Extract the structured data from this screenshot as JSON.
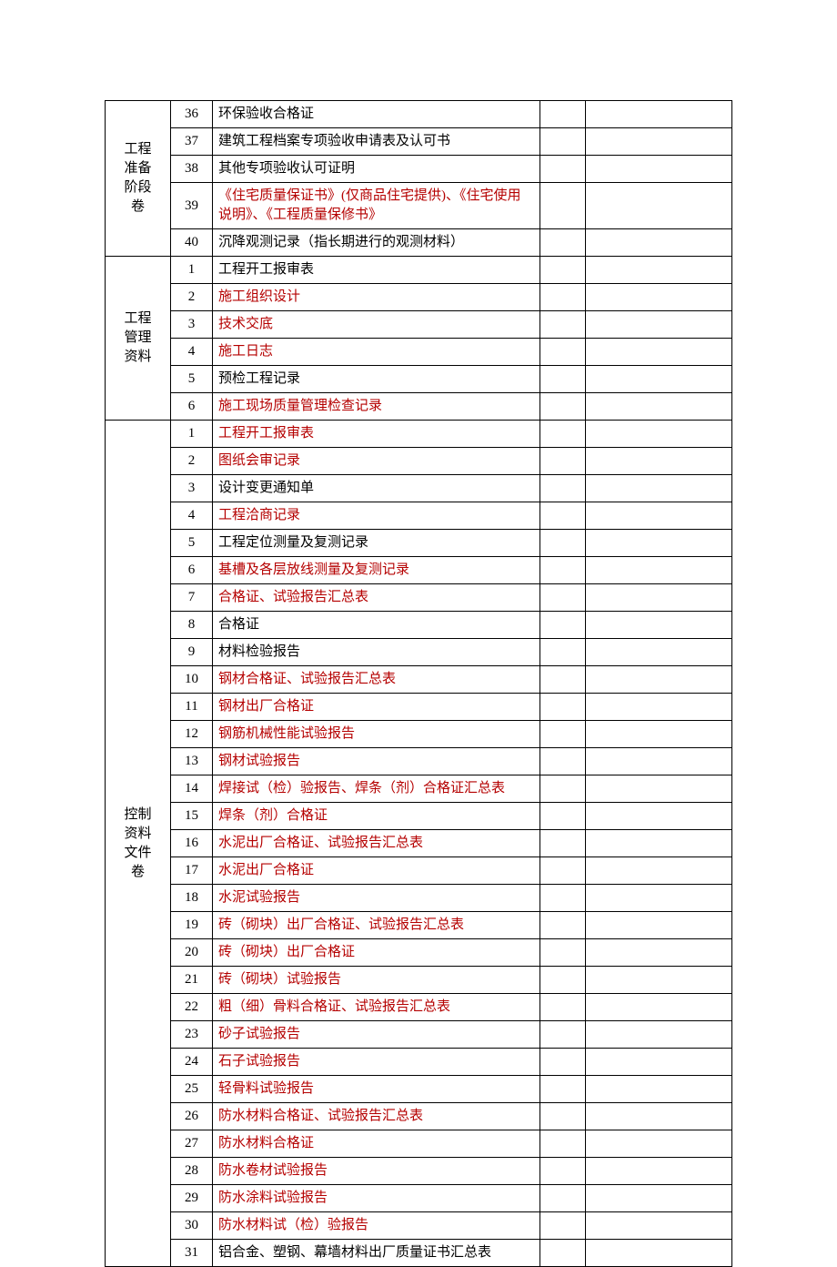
{
  "sections": [
    {
      "group_label": "工程准备阶段卷",
      "rows": [
        {
          "num": "36",
          "name": "环保验收合格证",
          "red": false
        },
        {
          "num": "37",
          "name": "建筑工程档案专项验收申请表及认可书",
          "red": false
        },
        {
          "num": "38",
          "name": "其他专项验收认可证明",
          "red": false
        },
        {
          "num": "39",
          "name": "《住宅质量保证书》(仅商品住宅提供)、《住宅使用说明》、《工程质量保修书》",
          "red": true
        },
        {
          "num": "40",
          "name": "沉降观测记录（指长期进行的观测材料）",
          "red": false
        }
      ]
    },
    {
      "group_label": "工程管理资料",
      "rows": [
        {
          "num": "1",
          "name": "工程开工报审表",
          "red": false
        },
        {
          "num": "2",
          "name": "施工组织设计",
          "red": true
        },
        {
          "num": "3",
          "name": "技术交底",
          "red": true
        },
        {
          "num": "4",
          "name": "施工日志",
          "red": true
        },
        {
          "num": "5",
          "name": "预检工程记录",
          "red": false
        },
        {
          "num": "6",
          "name": "施工现场质量管理检查记录",
          "red": true
        }
      ]
    },
    {
      "group_label": "控制资料文件卷",
      "rows": [
        {
          "num": "1",
          "name": "工程开工报审表",
          "red": true
        },
        {
          "num": "2",
          "name": "图纸会审记录",
          "red": true
        },
        {
          "num": "3",
          "name": "设计变更通知单",
          "red": false
        },
        {
          "num": "4",
          "name": "工程洽商记录",
          "red": true
        },
        {
          "num": "5",
          "name": "工程定位测量及复测记录",
          "red": false
        },
        {
          "num": "6",
          "name": "基槽及各层放线测量及复测记录",
          "red": true
        },
        {
          "num": "7",
          "name": "合格证、试验报告汇总表",
          "red": true
        },
        {
          "num": "8",
          "name": "合格证",
          "red": false
        },
        {
          "num": "9",
          "name": "材料检验报告",
          "red": false
        },
        {
          "num": "10",
          "name": "钢材合格证、试验报告汇总表",
          "red": true
        },
        {
          "num": "11",
          "name": "钢材出厂合格证",
          "red": true
        },
        {
          "num": "12",
          "name": "钢筋机械性能试验报告",
          "red": true
        },
        {
          "num": "13",
          "name": "钢材试验报告",
          "red": true
        },
        {
          "num": "14",
          "name": "焊接试（检）验报告、焊条（剂）合格证汇总表",
          "red": true
        },
        {
          "num": "15",
          "name": "焊条（剂）合格证",
          "red": true
        },
        {
          "num": "16",
          "name": "水泥出厂合格证、试验报告汇总表",
          "red": true
        },
        {
          "num": "17",
          "name": "水泥出厂合格证",
          "red": true
        },
        {
          "num": "18",
          "name": "水泥试验报告",
          "red": true
        },
        {
          "num": "19",
          "name": "砖（砌块）出厂合格证、试验报告汇总表",
          "red": true
        },
        {
          "num": "20",
          "name": "砖（砌块）出厂合格证",
          "red": true
        },
        {
          "num": "21",
          "name": "砖（砌块）试验报告",
          "red": true
        },
        {
          "num": "22",
          "name": "粗（细）骨料合格证、试验报告汇总表",
          "red": true
        },
        {
          "num": "23",
          "name": "砂子试验报告",
          "red": true
        },
        {
          "num": "24",
          "name": "石子试验报告",
          "red": true
        },
        {
          "num": "25",
          "name": "轻骨料试验报告",
          "red": true
        },
        {
          "num": "26",
          "name": "防水材料合格证、试验报告汇总表",
          "red": true
        },
        {
          "num": "27",
          "name": "防水材料合格证",
          "red": true
        },
        {
          "num": "28",
          "name": "防水卷材试验报告",
          "red": true
        },
        {
          "num": "29",
          "name": "防水涂料试验报告",
          "red": true
        },
        {
          "num": "30",
          "name": "防水材料试（检）验报告",
          "red": true
        },
        {
          "num": "31",
          "name": "铝合金、塑钢、幕墙材料出厂质量证书汇总表",
          "red": false
        }
      ]
    }
  ]
}
